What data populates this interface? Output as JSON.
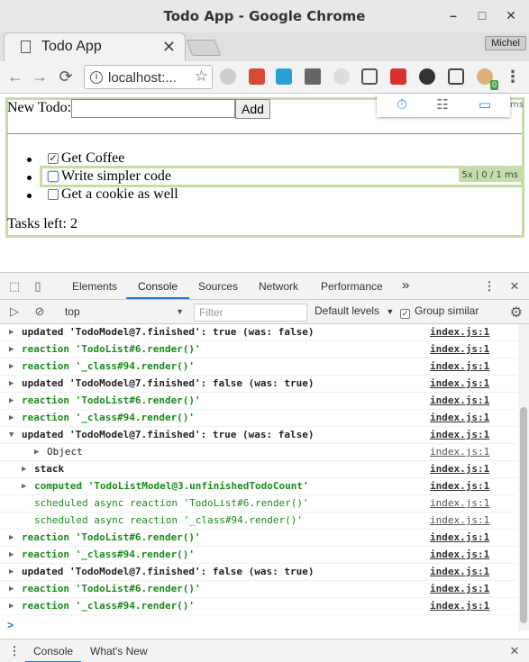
{
  "window": {
    "title": "Todo App - Google Chrome",
    "controls": [
      "minimize",
      "maximize",
      "close"
    ],
    "control_glyphs": {
      "minimize": "–",
      "maximize": "□",
      "close": "✕"
    }
  },
  "tabstrip": {
    "tab_title": "Todo App",
    "close_glyph": "✕",
    "user_name": "Michel"
  },
  "toolbar": {
    "back_glyph": "←",
    "forward_glyph": "→",
    "reload_glyph": "⟳",
    "info_glyph": "i",
    "url": "localhost:...",
    "star_glyph": "☆",
    "extension_badge": "0",
    "menu_glyph": "⋮"
  },
  "page": {
    "new_todo_label": "New Todo:",
    "new_todo_value": "",
    "add_label": "Add",
    "todos": [
      {
        "title": "Get Coffee",
        "finished": true
      },
      {
        "title": "Write simpler code",
        "finished": false
      },
      {
        "title": "Get a cookie as well",
        "finished": false
      }
    ],
    "tasks_left": "Tasks left: 2",
    "render_badge": "5x | 0 / 1 ms",
    "outline_badge": "ms",
    "check_glyph": "✓"
  },
  "devtools": {
    "tabs": [
      "Elements",
      "Console",
      "Sources",
      "Network",
      "Performance"
    ],
    "active_tab": "Console",
    "more_tabs_glyph": "»",
    "menu_glyph": "⋮",
    "close_glyph": "✕",
    "context": "top",
    "filter_placeholder": "Filter",
    "levels": "Default levels",
    "group_similar": "Group similar",
    "group_similar_checked": true,
    "gear_glyph": "⚙",
    "prompt_glyph": ">",
    "logs": [
      {
        "msg": "updated 'TodoModel@7.finished': true (was: false)",
        "src": "index.js:1",
        "color": "dark",
        "indent": 0,
        "tri": "▶"
      },
      {
        "msg": "reaction 'TodoList#6.render()'",
        "src": "index.js:1",
        "color": "green",
        "indent": 0,
        "tri": "▶"
      },
      {
        "msg": "reaction '_class#94.render()'",
        "src": "index.js:1",
        "color": "green",
        "indent": 0,
        "tri": "▶"
      },
      {
        "msg": "updated 'TodoModel@7.finished': false (was: true)",
        "src": "index.js:1",
        "color": "dark",
        "indent": 0,
        "tri": "▶"
      },
      {
        "msg": "reaction 'TodoList#6.render()'",
        "src": "index.js:1",
        "color": "green",
        "indent": 0,
        "tri": "▶"
      },
      {
        "msg": "reaction '_class#94.render()'",
        "src": "index.js:1",
        "color": "green",
        "indent": 0,
        "tri": "▶"
      },
      {
        "msg": "updated 'TodoModel@7.finished': true (was: false)",
        "src": "index.js:1",
        "color": "dark",
        "indent": 0,
        "tri": "▼"
      },
      {
        "msg": "Object",
        "src": "index.js:1",
        "color": "dark",
        "indent": 2,
        "tri": "▶",
        "child": true
      },
      {
        "msg": "stack",
        "src": "index.js:1",
        "color": "dark",
        "indent": 1,
        "tri": "▶"
      },
      {
        "msg": "computed 'TodoListModel@3.unfinishedTodoCount'",
        "src": "index.js:1",
        "color": "green",
        "indent": 1,
        "tri": "▶"
      },
      {
        "msg": "scheduled async reaction 'TodoList#6.render()'",
        "src": "index.js:1",
        "color": "green",
        "indent": 1,
        "tri": "",
        "child": true
      },
      {
        "msg": "scheduled async reaction '_class#94.render()'",
        "src": "index.js:1",
        "color": "green",
        "indent": 1,
        "tri": "",
        "child": true
      },
      {
        "msg": "reaction 'TodoList#6.render()'",
        "src": "index.js:1",
        "color": "green",
        "indent": 0,
        "tri": "▶"
      },
      {
        "msg": "reaction '_class#94.render()'",
        "src": "index.js:1",
        "color": "green",
        "indent": 0,
        "tri": "▶"
      },
      {
        "msg": "updated 'TodoModel@7.finished': false (was: true)",
        "src": "index.js:1",
        "color": "dark",
        "indent": 0,
        "tri": "▶"
      },
      {
        "msg": "reaction 'TodoList#6.render()'",
        "src": "index.js:1",
        "color": "green",
        "indent": 0,
        "tri": "▶"
      },
      {
        "msg": "reaction '_class#94.render()'",
        "src": "index.js:1",
        "color": "green",
        "indent": 0,
        "tri": "▶"
      }
    ],
    "drawer_tabs": [
      "Console",
      "What's New"
    ]
  },
  "colors": {
    "render_highlight": "#c5dca8",
    "accent": "#1a73e8",
    "log_green": "#1a8a1a"
  }
}
